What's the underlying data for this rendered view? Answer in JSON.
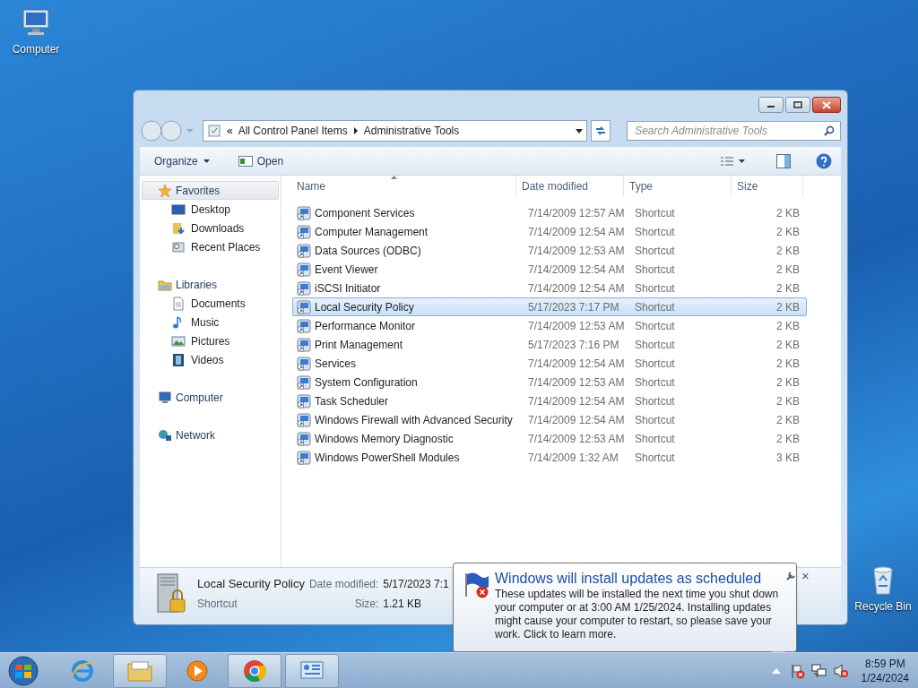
{
  "desktop_icons": [
    {
      "label": "Computer",
      "kind": "computer"
    },
    {
      "label": "Recycle Bin",
      "kind": "bin"
    }
  ],
  "address": {
    "overflow": "«",
    "crumbs": [
      "All Control Panel Items",
      "Administrative Tools"
    ]
  },
  "search": {
    "placeholder": "Search Administrative Tools"
  },
  "toolbar": {
    "organize": "Organize",
    "open": "Open"
  },
  "sidebar": [
    {
      "label": "Favorites",
      "kind": "favorites",
      "selected": true,
      "children": [
        {
          "label": "Desktop",
          "kind": "desktop"
        },
        {
          "label": "Downloads",
          "kind": "downloads"
        },
        {
          "label": "Recent Places",
          "kind": "recent"
        }
      ]
    },
    {
      "label": "Libraries",
      "kind": "libraries",
      "selected": false,
      "children": [
        {
          "label": "Documents",
          "kind": "documents"
        },
        {
          "label": "Music",
          "kind": "music"
        },
        {
          "label": "Pictures",
          "kind": "pictures"
        },
        {
          "label": "Videos",
          "kind": "videos"
        }
      ]
    },
    {
      "label": "Computer",
      "kind": "computer",
      "selected": false
    },
    {
      "label": "Network",
      "kind": "network",
      "selected": false
    }
  ],
  "table": {
    "columns": [
      "Name",
      "Date modified",
      "Type",
      "Size"
    ],
    "rows": [
      {
        "name": "Component Services",
        "date": "7/14/2009 12:57 AM",
        "type": "Shortcut",
        "size": "2 KB",
        "selected": false
      },
      {
        "name": "Computer Management",
        "date": "7/14/2009 12:54 AM",
        "type": "Shortcut",
        "size": "2 KB",
        "selected": false
      },
      {
        "name": "Data Sources (ODBC)",
        "date": "7/14/2009 12:53 AM",
        "type": "Shortcut",
        "size": "2 KB",
        "selected": false
      },
      {
        "name": "Event Viewer",
        "date": "7/14/2009 12:54 AM",
        "type": "Shortcut",
        "size": "2 KB",
        "selected": false
      },
      {
        "name": "iSCSI Initiator",
        "date": "7/14/2009 12:54 AM",
        "type": "Shortcut",
        "size": "2 KB",
        "selected": false
      },
      {
        "name": "Local Security Policy",
        "date": "5/17/2023 7:17 PM",
        "type": "Shortcut",
        "size": "2 KB",
        "selected": true
      },
      {
        "name": "Performance Monitor",
        "date": "7/14/2009 12:53 AM",
        "type": "Shortcut",
        "size": "2 KB",
        "selected": false
      },
      {
        "name": "Print Management",
        "date": "5/17/2023 7:16 PM",
        "type": "Shortcut",
        "size": "2 KB",
        "selected": false
      },
      {
        "name": "Services",
        "date": "7/14/2009 12:54 AM",
        "type": "Shortcut",
        "size": "2 KB",
        "selected": false
      },
      {
        "name": "System Configuration",
        "date": "7/14/2009 12:53 AM",
        "type": "Shortcut",
        "size": "2 KB",
        "selected": false
      },
      {
        "name": "Task Scheduler",
        "date": "7/14/2009 12:54 AM",
        "type": "Shortcut",
        "size": "2 KB",
        "selected": false
      },
      {
        "name": "Windows Firewall with Advanced Security",
        "date": "7/14/2009 12:54 AM",
        "type": "Shortcut",
        "size": "2 KB",
        "selected": false
      },
      {
        "name": "Windows Memory Diagnostic",
        "date": "7/14/2009 12:53 AM",
        "type": "Shortcut",
        "size": "2 KB",
        "selected": false
      },
      {
        "name": "Windows PowerShell Modules",
        "date": "7/14/2009 1:32 AM",
        "type": "Shortcut",
        "size": "3 KB",
        "selected": false
      }
    ]
  },
  "details": {
    "name": "Local Security Policy",
    "type": "Shortcut",
    "date_label": "Date modified:",
    "date": "5/17/2023 7:1",
    "size_label": "Size:",
    "size": "1.21 KB"
  },
  "balloon": {
    "title": "Windows will install updates as scheduled",
    "body": "These updates will be installed the next time you shut down your computer or at 3:00 AM 1/25/2024. Installing updates might cause your computer to restart, so please save your work. Click to learn more.",
    "close": "×"
  },
  "taskbar": [
    {
      "kind": "ie",
      "active": false
    },
    {
      "kind": "explorer",
      "active": true
    },
    {
      "kind": "media",
      "active": false
    },
    {
      "kind": "chrome",
      "active": true
    },
    {
      "kind": "control",
      "active": true
    }
  ],
  "clock": {
    "time": "8:59 PM",
    "date": "1/24/2024"
  }
}
